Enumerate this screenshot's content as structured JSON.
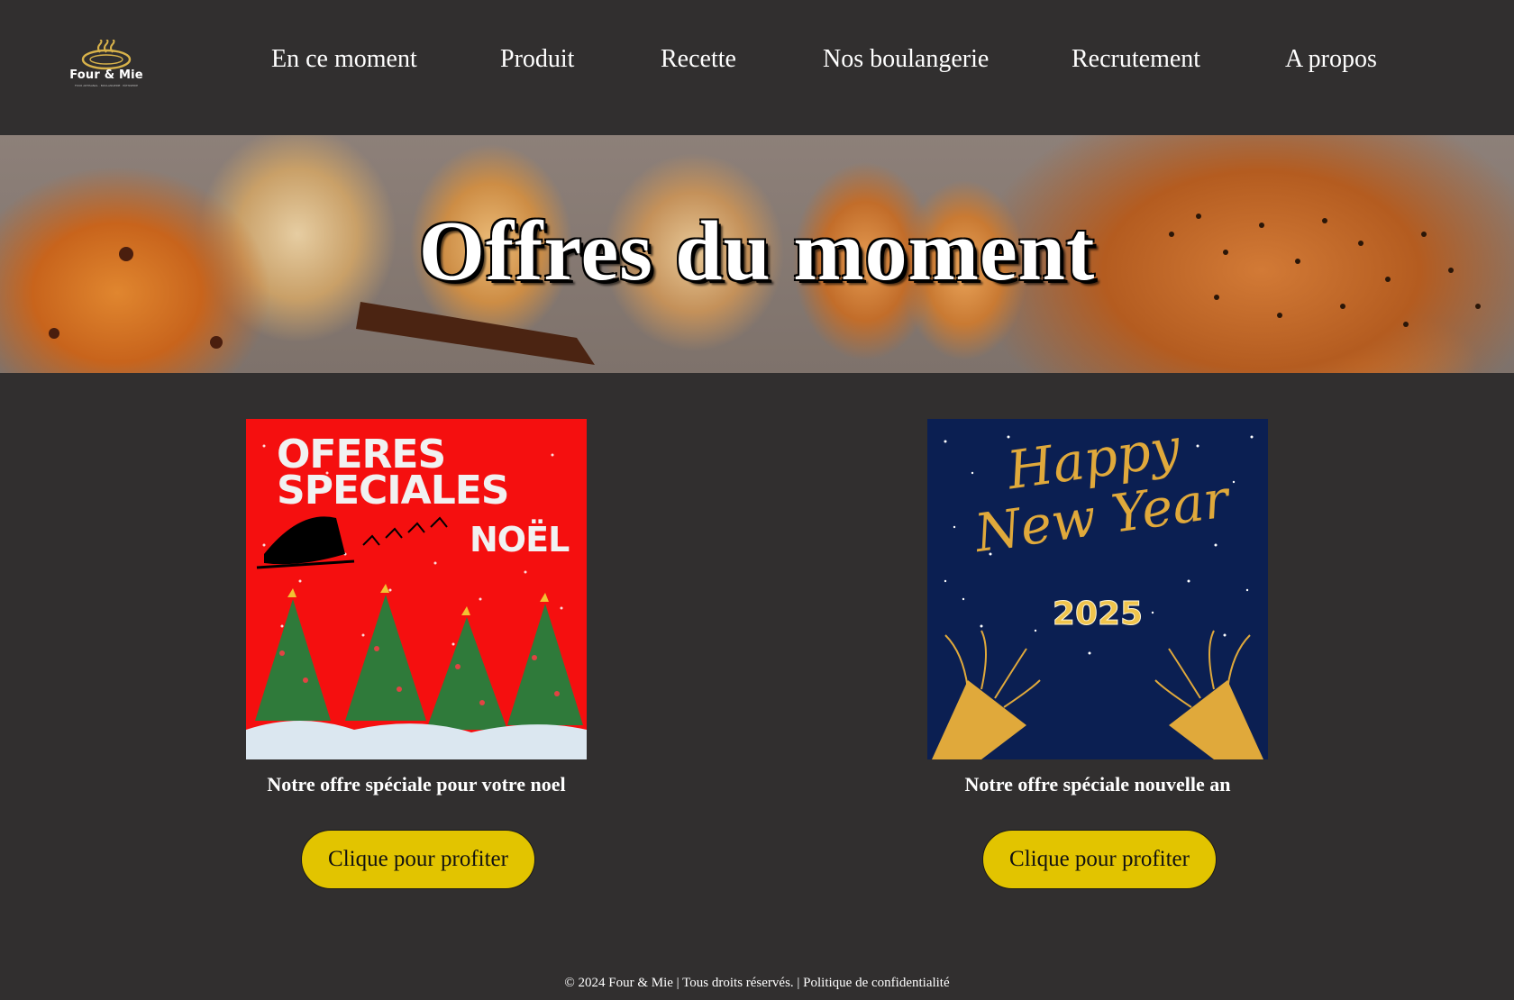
{
  "brand": {
    "name": "Four & Mie",
    "tagline": "FOUR ARTISANAL · BOULANGERIE · PÂTISSERIE"
  },
  "nav": [
    {
      "label": "En ce moment"
    },
    {
      "label": "Produit"
    },
    {
      "label": "Recette"
    },
    {
      "label": "Nos boulangerie"
    },
    {
      "label": "Recrutement"
    },
    {
      "label": "A propos"
    }
  ],
  "hero": {
    "title": "Offres du moment"
  },
  "offers": [
    {
      "image_text": {
        "line1": "OFERES",
        "line2": "SPECIALES",
        "line3": "NOËL"
      },
      "caption": "Notre offre spéciale pour votre noel",
      "button": "Clique pour profiter"
    },
    {
      "image_text": {
        "line1": "Happy",
        "line2": "New Year",
        "line3": "2025"
      },
      "caption": "Notre offre spéciale nouvelle an",
      "button": "Clique pour profiter"
    }
  ],
  "footer": {
    "copyright": "© 2024 Four & Mie | Tous droits réservés. | ",
    "privacy": "Politique de confidentialité"
  },
  "colors": {
    "background": "#312f2f",
    "button": "#e2c400",
    "noel_red": "#f50f0f",
    "newyear_navy": "#0b1f52",
    "gold": "#e0a93b"
  }
}
